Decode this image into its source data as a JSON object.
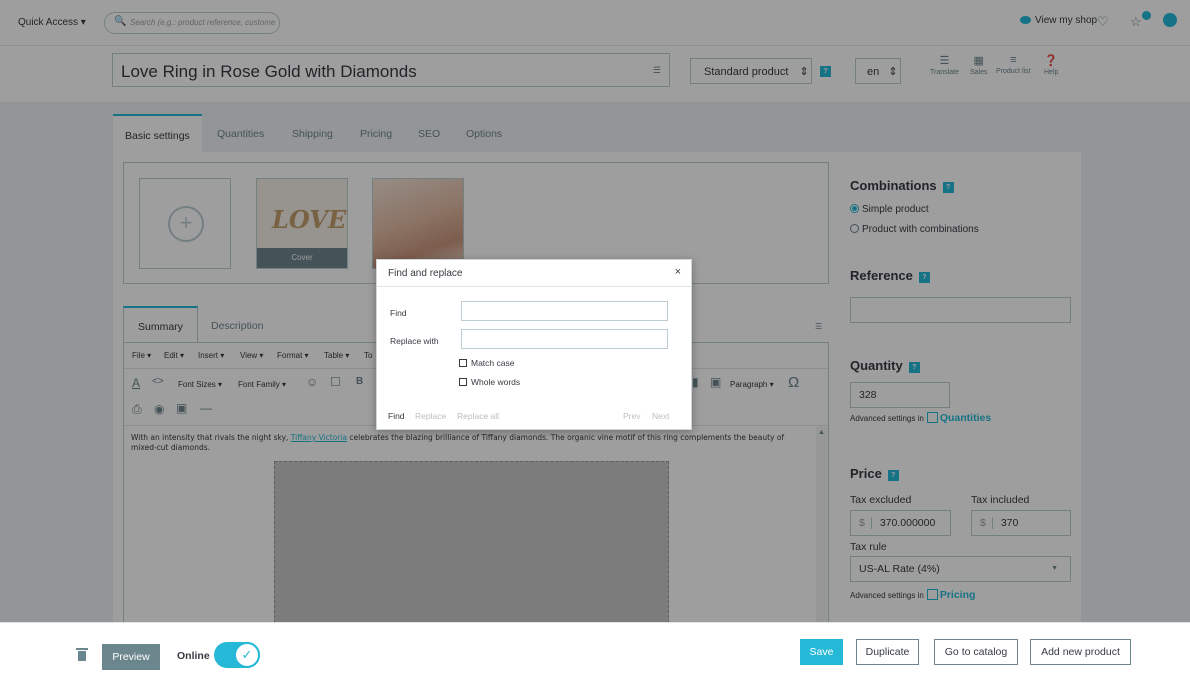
{
  "header": {
    "quick_access": "Quick Access ▾",
    "search_placeholder": "Search (e.g.: product reference, custome",
    "view_shop": "View my shop"
  },
  "product": {
    "name": "Love Ring in Rose Gold with Diamonds",
    "type": "Standard product",
    "lang": "en",
    "tools": [
      {
        "label": "Translate"
      },
      {
        "label": "Sales"
      },
      {
        "label": "Product list"
      },
      {
        "label": "Help"
      }
    ]
  },
  "tabs": [
    "Basic settings",
    "Quantities",
    "Shipping",
    "Pricing",
    "SEO",
    "Options"
  ],
  "images": {
    "cover_label": "Cover",
    "cover_text": "LOVE"
  },
  "summary_tabs": [
    "Summary",
    "Description"
  ],
  "editor": {
    "menu": [
      "File ▾",
      "Edit ▾",
      "Insert ▾",
      "View ▾",
      "Format ▾",
      "Table ▾",
      "To"
    ],
    "font_sizes": "Font Sizes ▾",
    "font_family": "Font Family ▾",
    "paragraph": "Paragraph ▾",
    "text_before": "With an intensity that rivals the night sky, ",
    "text_link": "Tiffany Victoria",
    "text_after": " celebrates the blazing brilliance of Tiffany diamonds. The organic vine motif of this ring complements the beauty of mixed-cut diamonds."
  },
  "right": {
    "combinations": "Combinations",
    "simple": "Simple product",
    "with_combinations": "Product with combinations",
    "reference": "Reference",
    "quantity": "Quantity",
    "quantity_value": "328",
    "advanced_prefix": "Advanced settings in",
    "quantities_link": "Quantities",
    "price": "Price",
    "tax_excluded": "Tax excluded",
    "tax_included": "Tax included",
    "currency": "$",
    "price_excl": "370.000000",
    "price_incl": "370",
    "tax_rule": "Tax rule",
    "tax_rule_value": "US-AL Rate (4%)",
    "pricing_link": "Pricing"
  },
  "dialog": {
    "title": "Find and replace",
    "close": "×",
    "find_label": "Find",
    "replace_label": "Replace with",
    "match_case": "Match case",
    "whole_words": "Whole words",
    "btn_find": "Find",
    "btn_replace": "Replace",
    "btn_replace_all": "Replace all",
    "btn_prev": "Prev",
    "btn_next": "Next"
  },
  "footer": {
    "preview": "Preview",
    "online": "Online",
    "save": "Save",
    "duplicate": "Duplicate",
    "go_to_catalog": "Go to catalog",
    "add_new_product": "Add new product"
  },
  "colors": {
    "accent": "#25b9d7",
    "text": "#363a41",
    "muted": "#6c868e",
    "border": "#bbcdd2"
  }
}
